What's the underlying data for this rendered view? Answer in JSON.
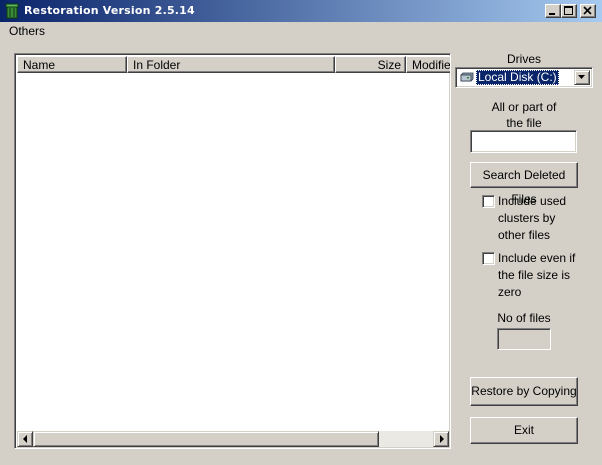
{
  "window": {
    "title": "Restoration Version 2.5.14",
    "icons": {
      "app": "recycle-bin-icon",
      "minimize": "minimize-icon",
      "maximize": "maximize-icon",
      "close": "close-icon"
    }
  },
  "menu": {
    "items": [
      {
        "label": "Others"
      }
    ]
  },
  "file_list": {
    "columns": [
      {
        "label": "Name"
      },
      {
        "label": "In Folder"
      },
      {
        "label": "Size"
      },
      {
        "label": "Modified"
      }
    ],
    "rows": []
  },
  "drives": {
    "label": "Drives",
    "selected": "Local Disk (C:)",
    "icon": "hard-drive-icon"
  },
  "search": {
    "label_line1": "All or part of",
    "label_line2": "the file",
    "value": "",
    "button_label": "Search Deleted Files"
  },
  "options": {
    "include_used_clusters": {
      "line1": "Include used",
      "line2": "clusters by",
      "line3": "other files",
      "checked": false
    },
    "include_zero_size": {
      "line1": "Include even if",
      "line2": "the file size is",
      "line3": "zero",
      "checked": false
    }
  },
  "count": {
    "label": "No of files",
    "value": ""
  },
  "actions": {
    "restore_label": "Restore by Copying",
    "exit_label": "Exit"
  },
  "colors": {
    "face": "#d4d0c8",
    "titlebar_start": "#0a246a",
    "titlebar_end": "#a6caf0",
    "selection": "#0a246a"
  }
}
